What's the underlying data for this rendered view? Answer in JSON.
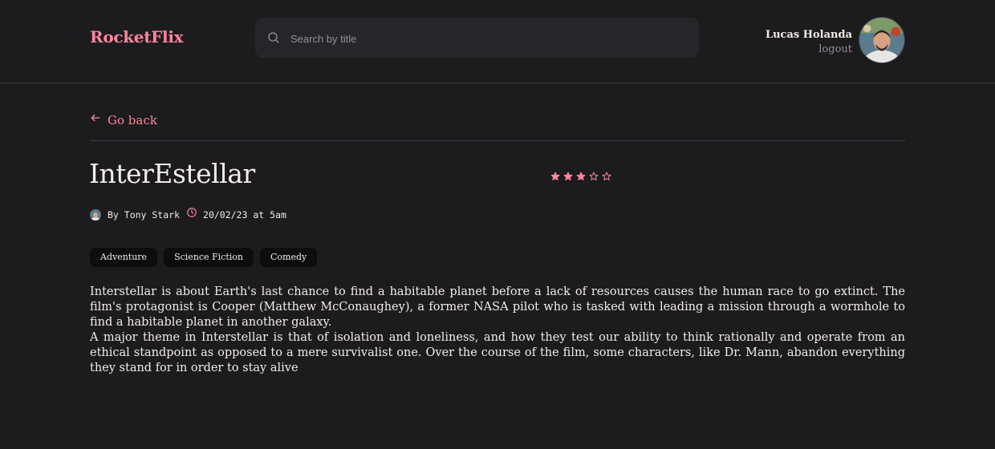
{
  "header": {
    "logo": "RocketFlix",
    "search": {
      "placeholder": "Search by title",
      "value": ""
    },
    "user": {
      "name": "Lucas Holanda",
      "logout_label": "logout"
    }
  },
  "nav": {
    "go_back_label": "Go back"
  },
  "movie": {
    "title": "InterEstellar",
    "rating": {
      "value": 3,
      "max": 5
    },
    "author": "By Tony Stark",
    "datetime": "20/02/23 at 5am",
    "tags": [
      "Adventure",
      "Science Fiction",
      "Comedy"
    ],
    "description": [
      "Interstellar is about Earth's last chance to find a habitable planet before a lack of resources causes the human race to go extinct. The film's protagonist is Cooper (Matthew McConaughey), a former NASA pilot who is tasked with leading a mission through a wormhole to find a habitable planet in another galaxy.",
      "A major theme in Interstellar is that of isolation and loneliness, and how they test our ability to think rationally and operate from an ethical standpoint as opposed to a mere survivalist one. Over the course of the film, some characters, like Dr. Mann, abandon everything they stand for in order to stay alive"
    ]
  },
  "colors": {
    "background": "#1c1b1e",
    "accent": "#ff859b",
    "surface": "#262529",
    "tag_background": "#0d0c0f",
    "muted_text": "#948f99"
  },
  "icons": {
    "search": "search-icon",
    "back": "arrow-left-icon",
    "clock": "clock-icon",
    "star_filled": "star-filled-icon",
    "star_empty": "star-outline-icon"
  }
}
